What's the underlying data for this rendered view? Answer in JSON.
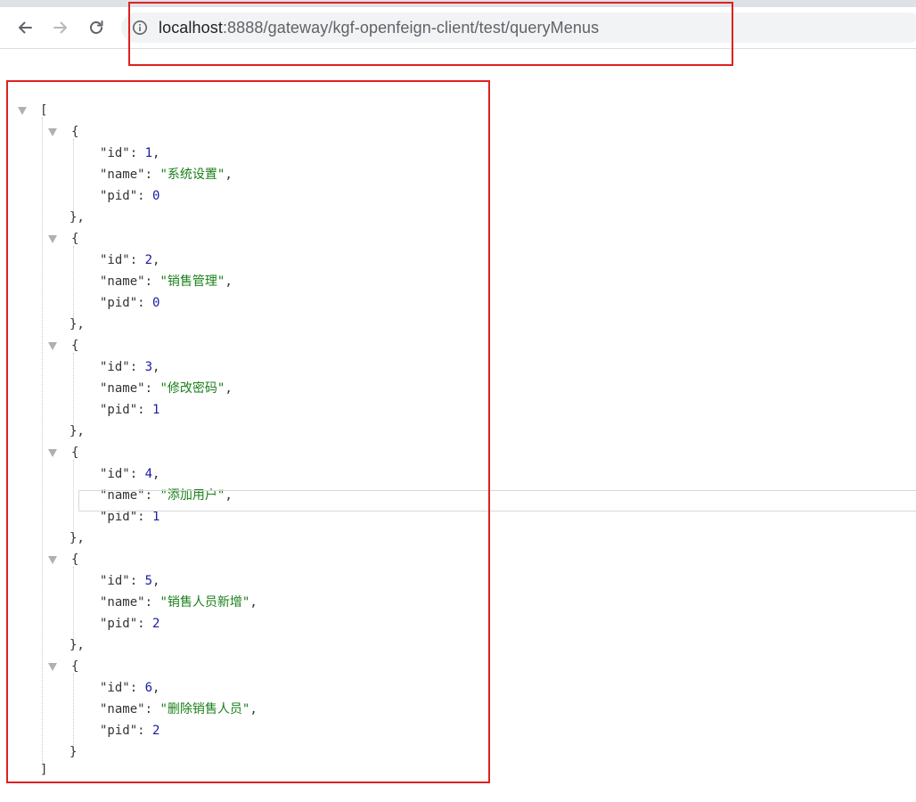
{
  "browser": {
    "url_host": "localhost",
    "url_rest": ":8888/gateway/kgf-openfeign-client/test/queryMenus",
    "icons": [
      "back-arrow-icon",
      "forward-arrow-icon",
      "reload-icon",
      "site-info-icon"
    ]
  },
  "json": {
    "open_bracket": "[",
    "close_bracket": "]",
    "open_brace": "{",
    "close_brace": "}",
    "close_brace_comma": "},",
    "keys": {
      "id": "\"id\":",
      "name": "\"name\":",
      "pid": "\"pid\":"
    },
    "items": [
      {
        "id": "1",
        "name": "\"系统设置\"",
        "pid": "0"
      },
      {
        "id": "2",
        "name": "\"销售管理\"",
        "pid": "0"
      },
      {
        "id": "3",
        "name": "\"修改密码\"",
        "pid": "1"
      },
      {
        "id": "4",
        "name": "\"添加用户\"",
        "pid": "1"
      },
      {
        "id": "5",
        "name": "\"销售人员新增\"",
        "pid": "2"
      },
      {
        "id": "6",
        "name": "\"删除销售人员\"",
        "pid": "2"
      }
    ]
  },
  "colors": {
    "annotation": "#e02020",
    "number": "#1a1aa6",
    "string": "#1a7f1a"
  }
}
